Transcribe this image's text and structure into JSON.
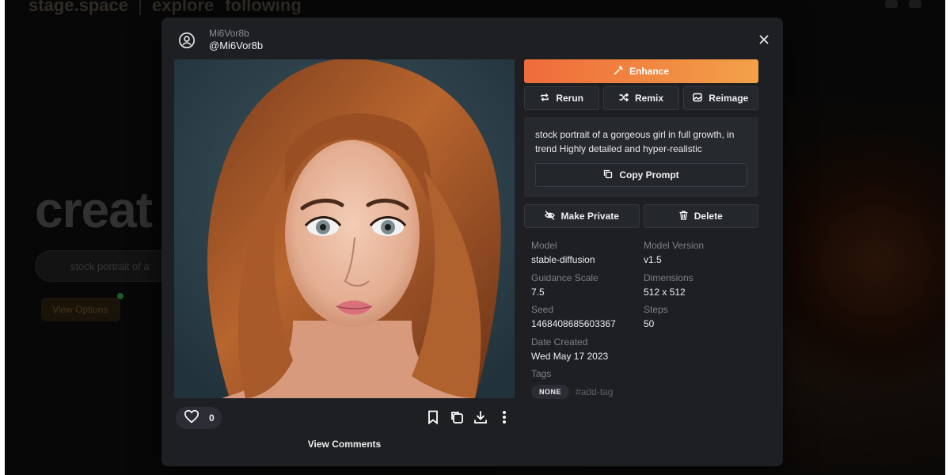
{
  "background": {
    "nav": [
      "stage.space",
      "explore",
      "following"
    ],
    "hero_text": "creat",
    "search_placeholder": "stock portrait of a",
    "view_options_label": "View Options"
  },
  "modal": {
    "header": {
      "username": "Mi6Vor8b",
      "handle": "@Mi6Vor8b",
      "avatar_icon": "user-circle-icon",
      "close_icon": "close-icon"
    },
    "image": {
      "watermark": "",
      "description_icon": "generated-image"
    },
    "likes": {
      "count": "0",
      "icon": "heart-icon"
    },
    "image_actions": [
      {
        "name": "bookmark-icon"
      },
      {
        "name": "copy-icon"
      },
      {
        "name": "download-icon"
      },
      {
        "name": "more-vertical-icon"
      }
    ],
    "view_comments_label": "View Comments",
    "actions": {
      "enhance_label": "Enhance",
      "rerun_label": "Rerun",
      "remix_label": "Remix",
      "reimage_label": "Reimage",
      "make_private_label": "Make Private",
      "delete_label": "Delete"
    },
    "prompt": {
      "text": "stock portrait of a gorgeous girl in full growth, in trend Highly detailed and hyper-realistic",
      "copy_label": "Copy Prompt"
    },
    "metadata": {
      "model_label": "Model",
      "model_value": "stable-diffusion",
      "model_version_label": "Model Version",
      "model_version_value": "v1.5",
      "guidance_label": "Guidance Scale",
      "guidance_value": "7.5",
      "dimensions_label": "Dimensions",
      "dimensions_value": "512 x 512",
      "seed_label": "Seed",
      "seed_value": "1468408685603367",
      "steps_label": "Steps",
      "steps_value": "50",
      "date_label": "Date Created",
      "date_value": "Wed May 17 2023",
      "tags_label": "Tags",
      "tag_none": "NONE",
      "add_tag": "#add-tag"
    },
    "colors": {
      "modal_bg": "#1d1f23",
      "enhance_start": "#ef6b3b",
      "enhance_end": "#f3a149"
    }
  }
}
